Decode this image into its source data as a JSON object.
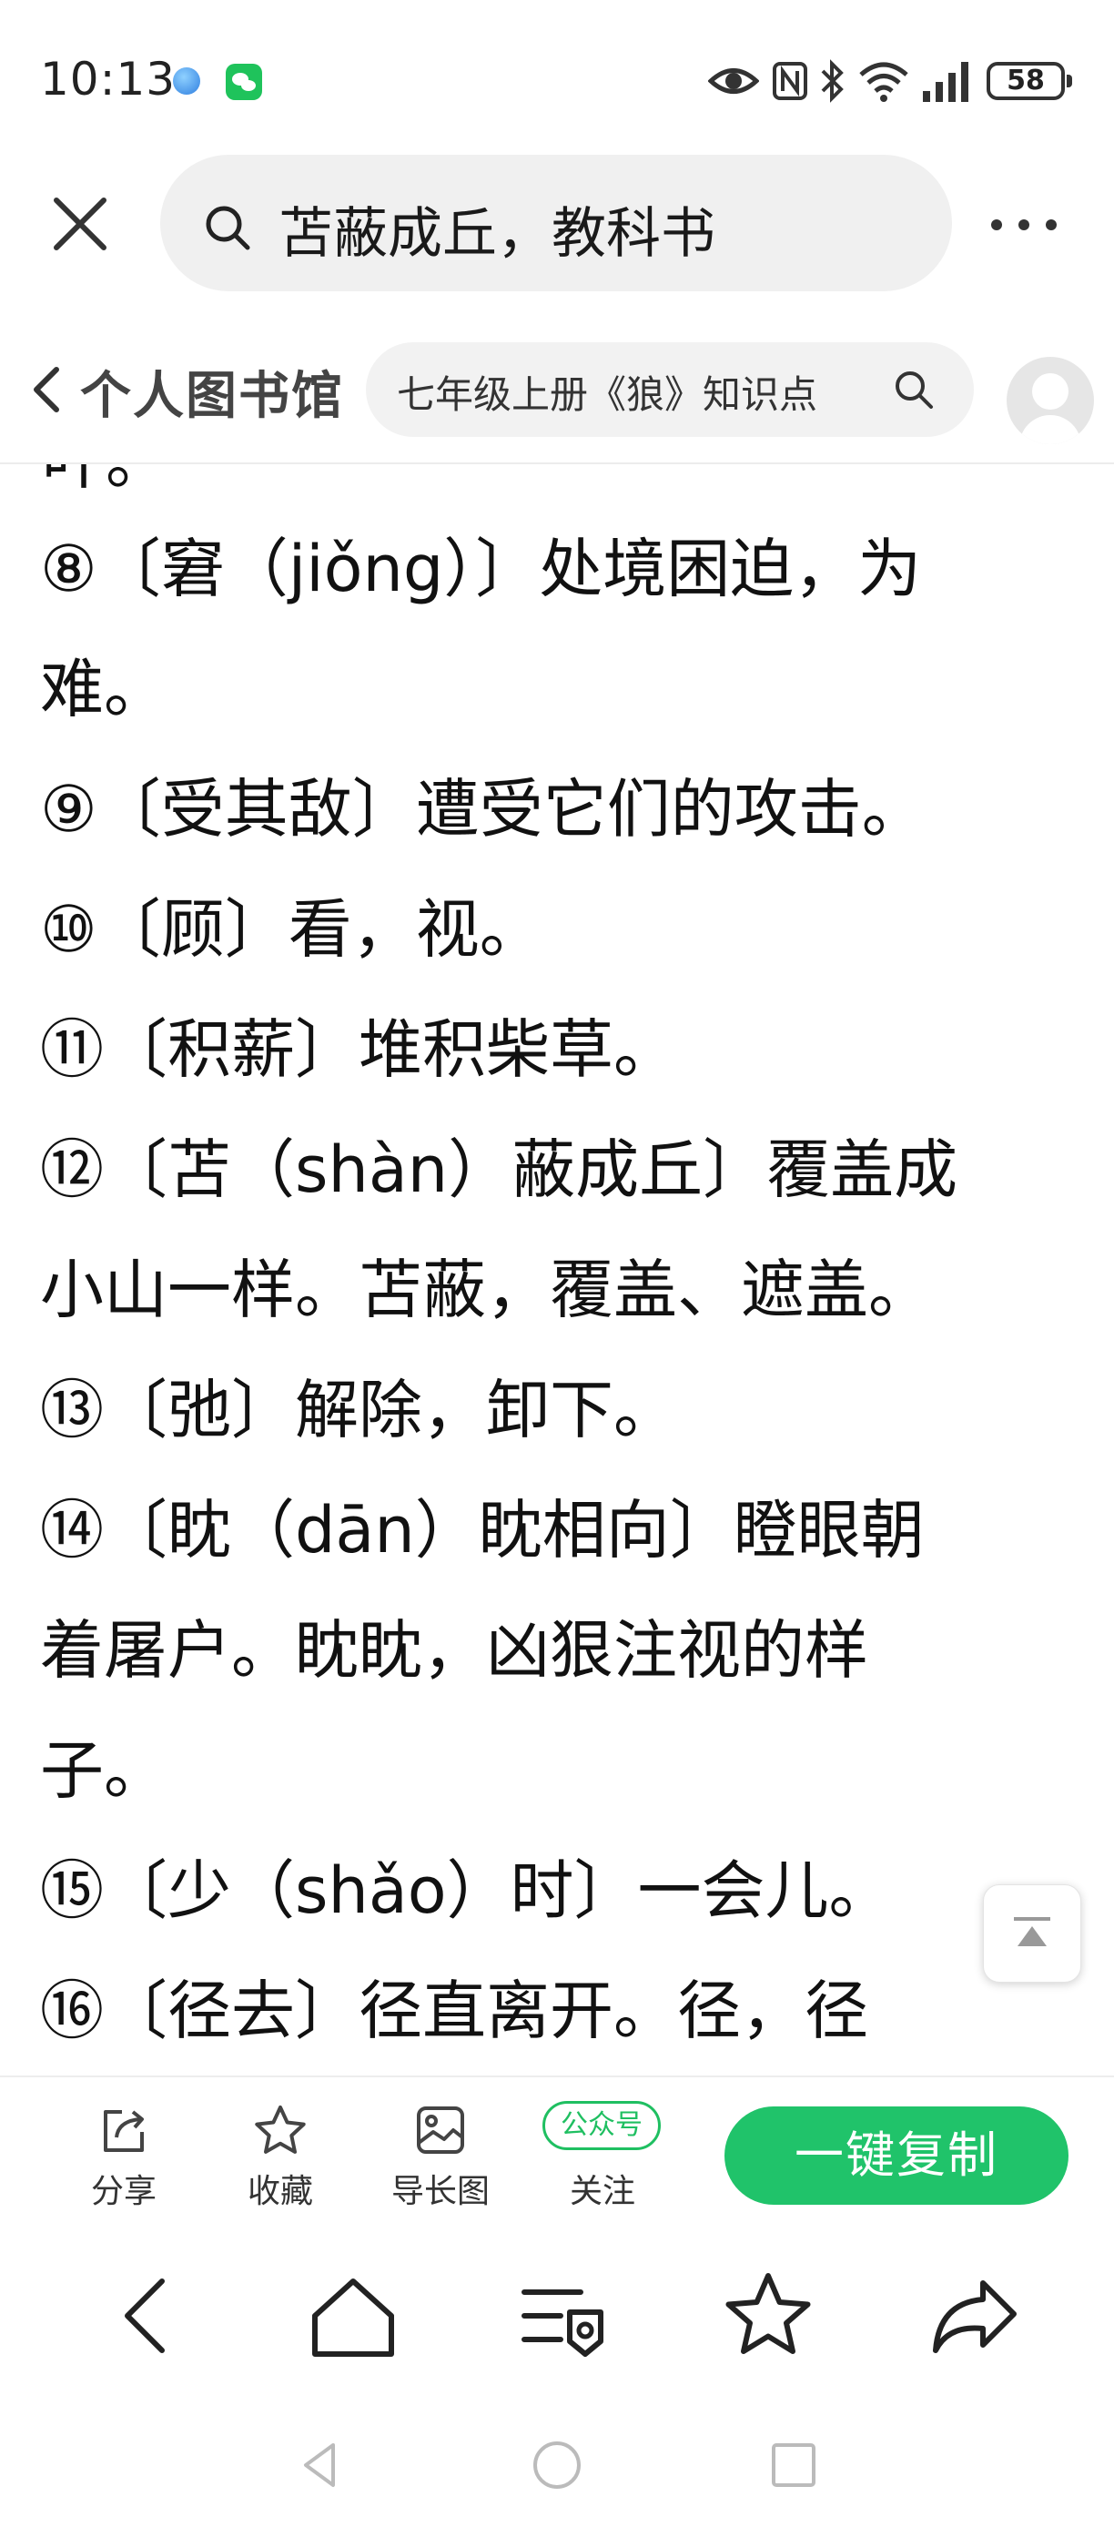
{
  "status_bar": {
    "time": "10:13",
    "battery": "58"
  },
  "search": {
    "query": "苫蔽成丘，教科书"
  },
  "library": {
    "title": "个人图书馆",
    "search_text": "七年级上册《狼》知识点"
  },
  "article": {
    "partial_top": "叶。",
    "lines": [
      "⑧〔窘（jiǒng）〕处境困迫，为",
      "难。",
      "⑨〔受其敌〕遭受它们的攻击。",
      "⑩〔顾〕看，视。",
      "⑪〔积薪〕堆积柴草。",
      "⑫〔苫（shàn）蔽成丘〕覆盖成",
      "小山一样。苫蔽，覆盖、遮盖。",
      "⑬〔弛〕解除，卸下。",
      "⑭〔眈（dān）眈相向〕瞪眼朝",
      "着屠户。眈眈，凶狠注视的样",
      "子。",
      "⑮〔少（shǎo）时〕一会儿。",
      "⑯〔径去〕径直离开。径，径"
    ]
  },
  "action_bar": {
    "share": "分享",
    "favorite": "收藏",
    "long_image": "导长图",
    "official_badge": "公众号",
    "follow": "关注",
    "copy": "一键复制"
  },
  "colors": {
    "accent_green": "#20c36a",
    "background": "#ffffff"
  }
}
